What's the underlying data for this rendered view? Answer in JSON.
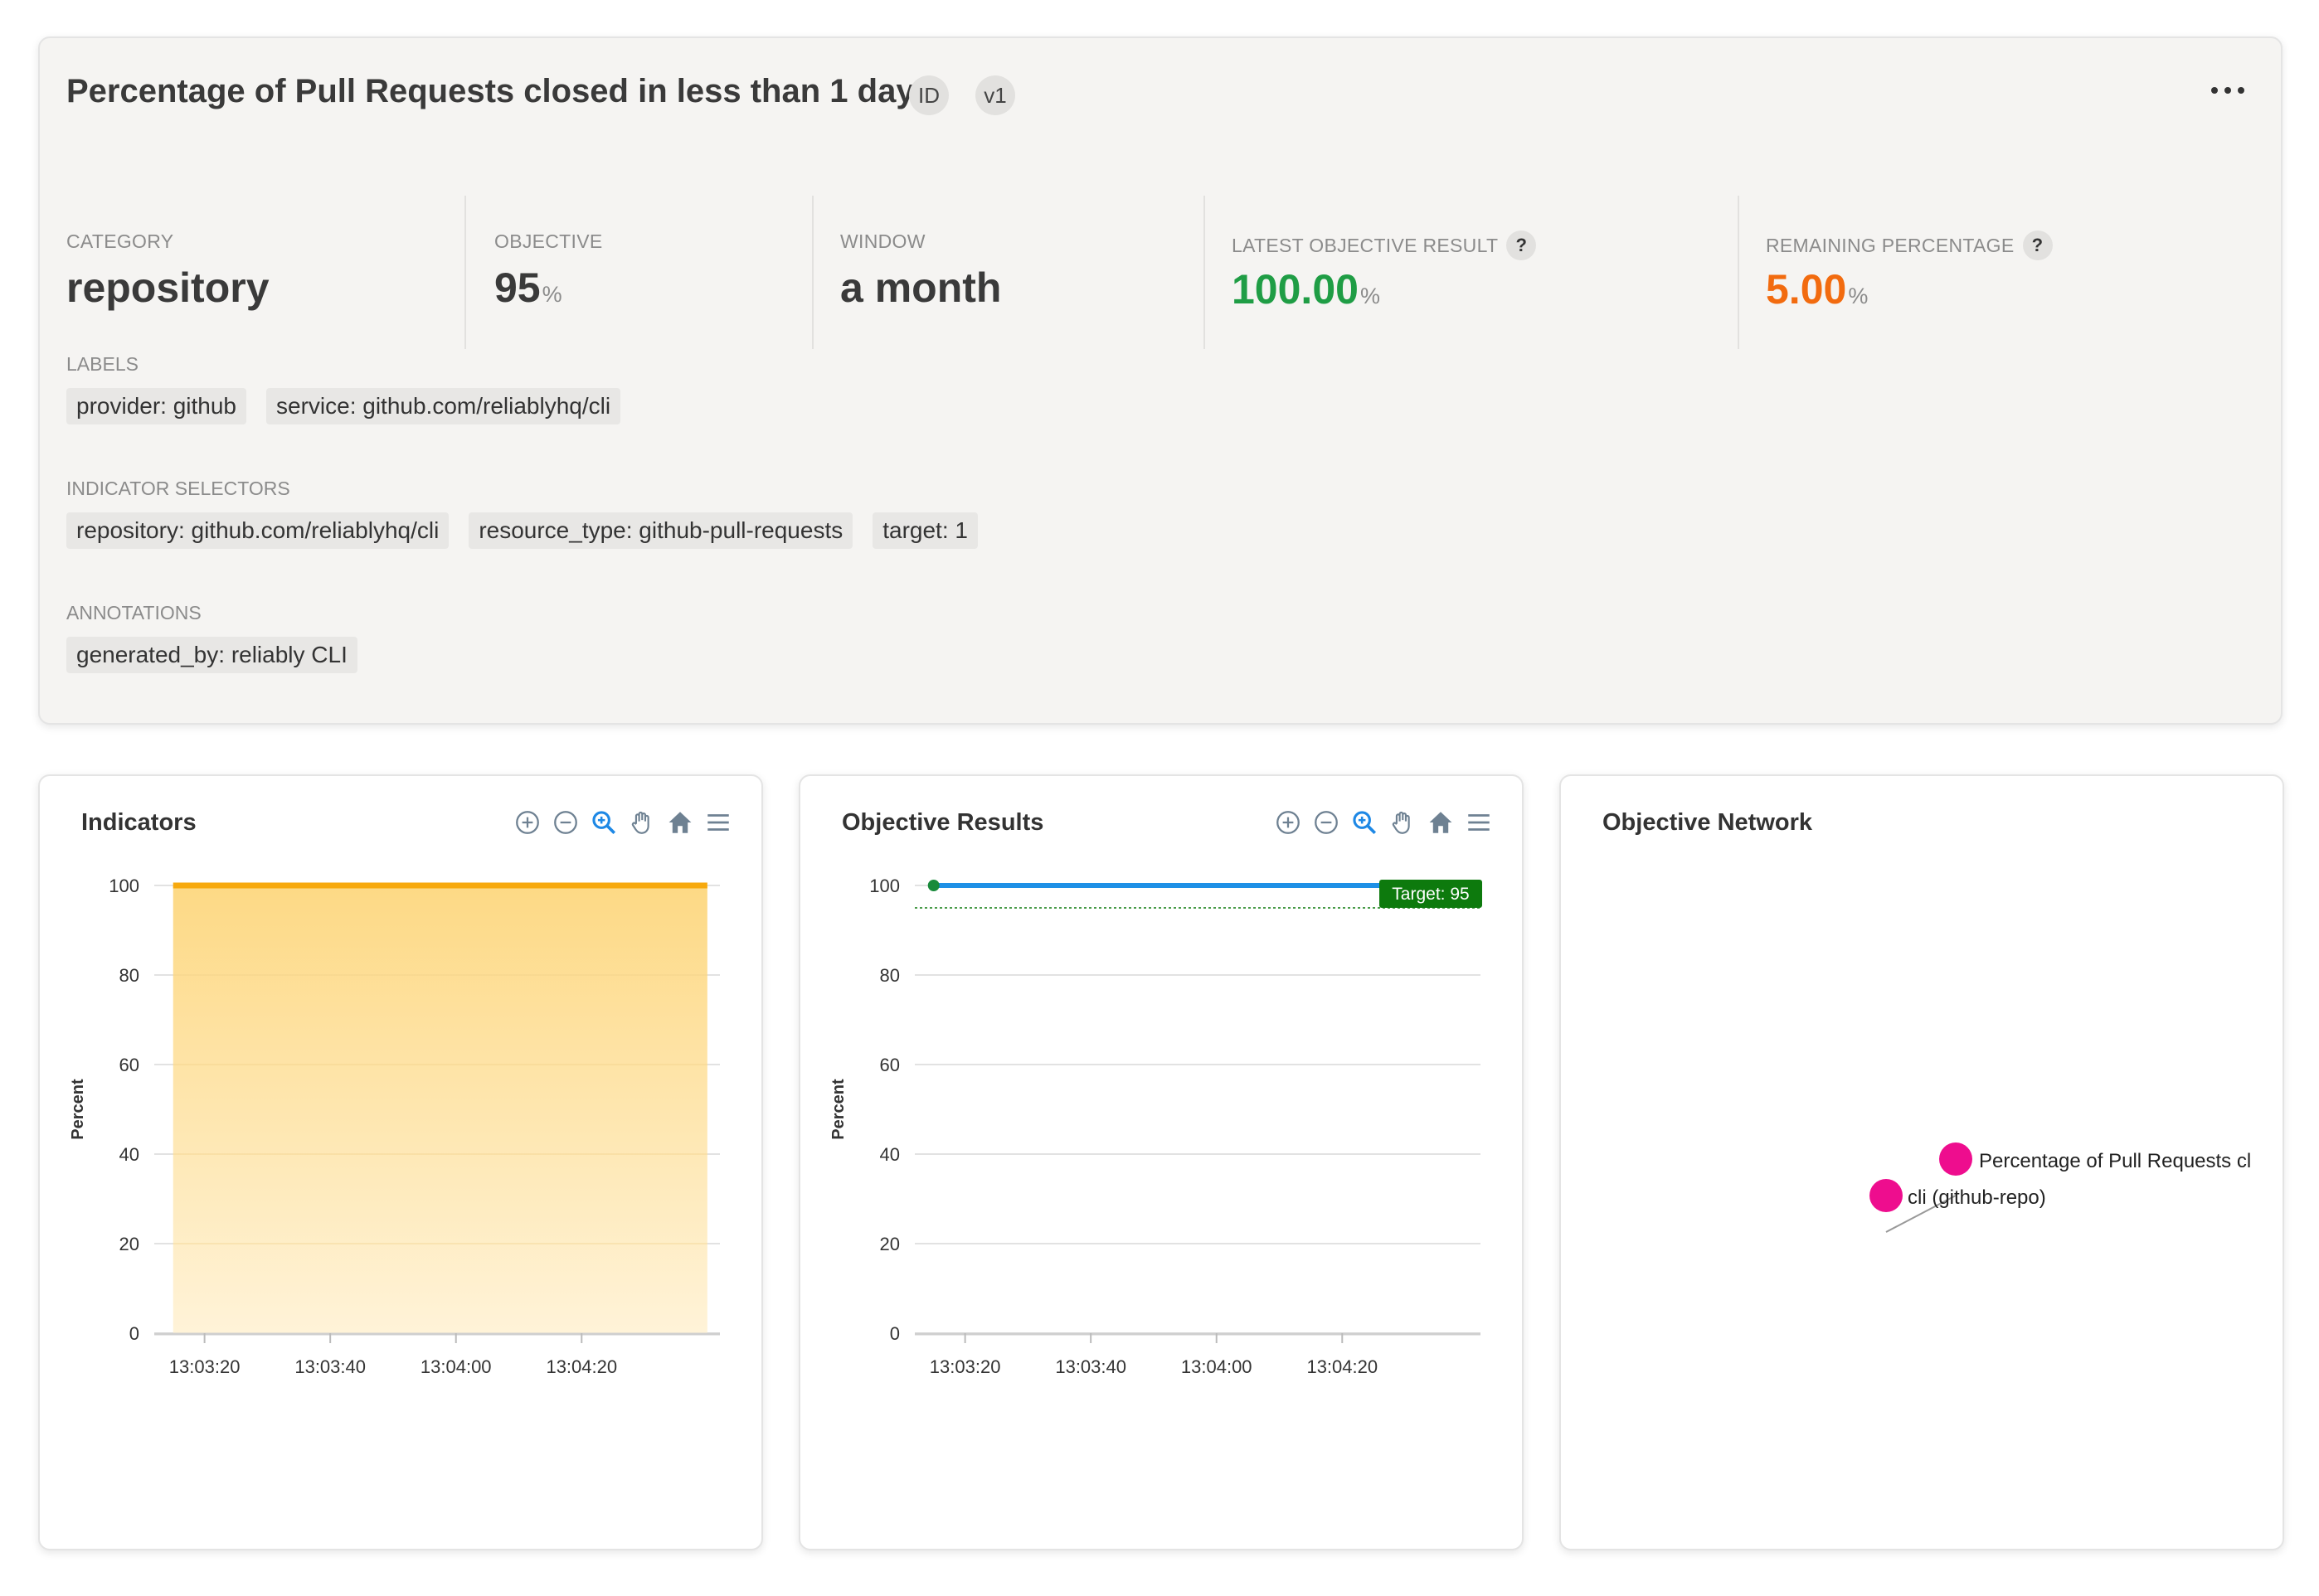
{
  "objective": {
    "title": "Percentage of Pull Requests closed in less than 1 days",
    "badges": [
      "ID",
      "v1"
    ],
    "menu_icon": "more-horizontal-icon",
    "stats": {
      "category": {
        "label": "CATEGORY",
        "value": "repository"
      },
      "objective": {
        "label": "OBJECTIVE",
        "value": "95",
        "unit": "%"
      },
      "window": {
        "label": "WINDOW",
        "value": "a month"
      },
      "latest_result": {
        "label": "LATEST OBJECTIVE RESULT",
        "value": "100.00",
        "unit": "%",
        "help": "?",
        "color": "#1f9d45"
      },
      "remaining": {
        "label": "REMAINING PERCENTAGE",
        "value": "5.00",
        "unit": "%",
        "help": "?",
        "color": "#f26b0f"
      }
    },
    "labels": {
      "label": "LABELS",
      "items": [
        "provider: github",
        "service: github.com/reliablyhq/cli"
      ]
    },
    "indicator_selectors": {
      "label": "INDICATOR SELECTORS",
      "items": [
        "repository: github.com/reliablyhq/cli",
        "resource_type: github-pull-requests",
        "target: 1"
      ]
    },
    "annotations": {
      "label": "ANNOTATIONS",
      "items": [
        "generated_by: reliably CLI"
      ]
    }
  },
  "toolbar_icons": [
    "zoom-in-icon",
    "zoom-out-icon",
    "selection-zoom-icon",
    "pan-hand-icon",
    "home-reset-icon",
    "menu-icon"
  ],
  "indicators_panel": {
    "title": "Indicators"
  },
  "results_panel": {
    "title": "Objective Results"
  },
  "network_panel": {
    "title": "Objective Network",
    "nodes": [
      {
        "label": "Percentage of Pull Requests cl",
        "color": "#ee0d8e"
      },
      {
        "label": "cli (github-repo)",
        "color": "#ee0d8e"
      }
    ]
  },
  "chart_data": [
    {
      "type": "area",
      "title": "Indicators",
      "ylabel": "Percent",
      "xlabel": "",
      "ylim": [
        0,
        100
      ],
      "yticks": [
        "0",
        "20",
        "40",
        "60",
        "80",
        "100"
      ],
      "xticks": [
        "13:03:20",
        "13:03:40",
        "13:04:00",
        "13:04:20"
      ],
      "series": [
        {
          "x": [
            "13:03:15",
            "13:04:40"
          ],
          "values": [
            100,
            100
          ],
          "color": "#f7a90d"
        }
      ],
      "grid": true
    },
    {
      "type": "line",
      "title": "Objective Results",
      "ylabel": "Percent",
      "xlabel": "",
      "ylim": [
        0,
        100
      ],
      "yticks": [
        "0",
        "20",
        "40",
        "60",
        "80",
        "100"
      ],
      "xticks": [
        "13:03:20",
        "13:03:40",
        "13:04:00",
        "13:04:20"
      ],
      "series": [
        {
          "x": [
            "13:03:15",
            "13:04:40"
          ],
          "values": [
            100,
            100
          ],
          "color": "#1e90e6"
        }
      ],
      "target": {
        "value": 95,
        "label": "Target: 95",
        "color": "#0d7a0d"
      },
      "grid": true
    }
  ]
}
